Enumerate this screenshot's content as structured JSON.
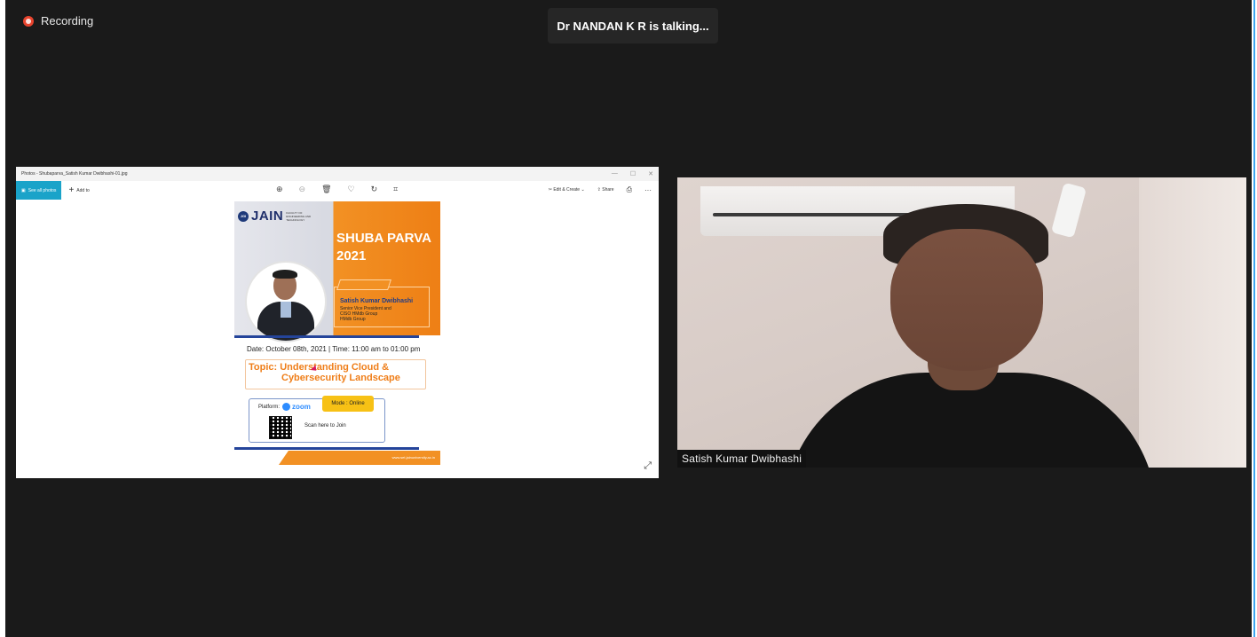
{
  "app": {
    "recording_label": "Recording",
    "talking_banner": "Dr NANDAN K R is talking..."
  },
  "shared_window": {
    "title": "Photos - Shubaparva_Satish Kumar Dwibhashi-01.jpg",
    "see_all_label": "See all photos",
    "add_to_label": "Add to",
    "edit_create_label": "Edit & Create",
    "share_label": "Share"
  },
  "poster": {
    "logo_text": "JAIN",
    "logo_badge": "JGI",
    "faculty_text": "FACULTY OF ENGINEERING AND TECHNOLOGY",
    "event_title": "SHUBA PARVA",
    "event_year": "2021",
    "speaker_name": "Satish Kumar Dwibhashi",
    "speaker_role_1": "Senior Vice President and",
    "speaker_role_2": "CISO HMdb Group",
    "speaker_role_3": "HMdb Group",
    "date_time": "Date: October 08th, 2021  |  Time: 11:00 am to 01:00 pm",
    "topic_line_1": "Topic: Understanding Cloud &",
    "topic_line_2": "Cybersecurity Landscape",
    "platform_label": "Platform:",
    "platform_name": "zoom",
    "mode_label": "Mode : Online",
    "scan_label": "Scan here to Join",
    "website": "www.set.jainuniversity.ac.in"
  },
  "participant": {
    "name": "Satish Kumar Dwibhashi"
  },
  "colors": {
    "stage_bg": "#1a1a1a",
    "accent_orange": "#f29124",
    "accent_blue": "#24449a",
    "photos_accent": "#1aa3c9",
    "recording_red": "#e8442e"
  }
}
